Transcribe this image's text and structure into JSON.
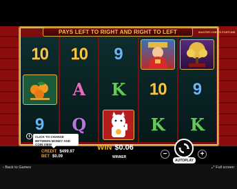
{
  "banner": {
    "text": "PAYS LEFT TO RIGHT AND RIGHT TO LEFT"
  },
  "logo": {
    "text": "MASTER CHEN'S FORTUNE"
  },
  "reels": [
    [
      {
        "type": "text",
        "symbol": "10",
        "cls": "sym-10"
      },
      {
        "type": "pic",
        "symbol": "oranges",
        "cls": "pic-oranges"
      },
      {
        "type": "text",
        "symbol": "9",
        "cls": "sym-9"
      }
    ],
    [
      {
        "type": "text",
        "symbol": "10",
        "cls": "sym-10"
      },
      {
        "type": "text",
        "symbol": "A",
        "cls": "sym-a"
      },
      {
        "type": "text",
        "symbol": "Q",
        "cls": "sym-q"
      }
    ],
    [
      {
        "type": "text",
        "symbol": "9",
        "cls": "sym-9"
      },
      {
        "type": "text",
        "symbol": "K",
        "cls": "sym-k"
      },
      {
        "type": "pic",
        "symbol": "lucky-cat",
        "cls": "pic-cat"
      }
    ],
    [
      {
        "type": "pic",
        "symbol": "fortune-god",
        "cls": "pic-god"
      },
      {
        "type": "text",
        "symbol": "10",
        "cls": "sym-10"
      },
      {
        "type": "text",
        "symbol": "K",
        "cls": "sym-k"
      }
    ],
    [
      {
        "type": "pic",
        "symbol": "money-tree",
        "cls": "pic-tree"
      },
      {
        "type": "text",
        "symbol": "9",
        "cls": "sym-9"
      },
      {
        "type": "text",
        "symbol": "K",
        "cls": "sym-k"
      }
    ]
  ],
  "tooltip": {
    "text": "CLICK TO CHANGE BETWEEN MONEY AND COIN VIEW"
  },
  "credit": {
    "label": "CREDIT",
    "value": "$499.97"
  },
  "bet": {
    "label": "BET",
    "value": "$0.09"
  },
  "win": {
    "label": "WIN",
    "value": "$0.06",
    "caption": "WINNER"
  },
  "controls": {
    "minus": "−",
    "plus": "+",
    "autoplay": "AUTOPLAY",
    "info": "i"
  },
  "footer": {
    "back": "Back to Games",
    "fullscreen": "Full screen"
  },
  "colors": {
    "accent": "#f2b21e",
    "frame": "#c7983a",
    "reel_bg": "#0d2d2e"
  }
}
